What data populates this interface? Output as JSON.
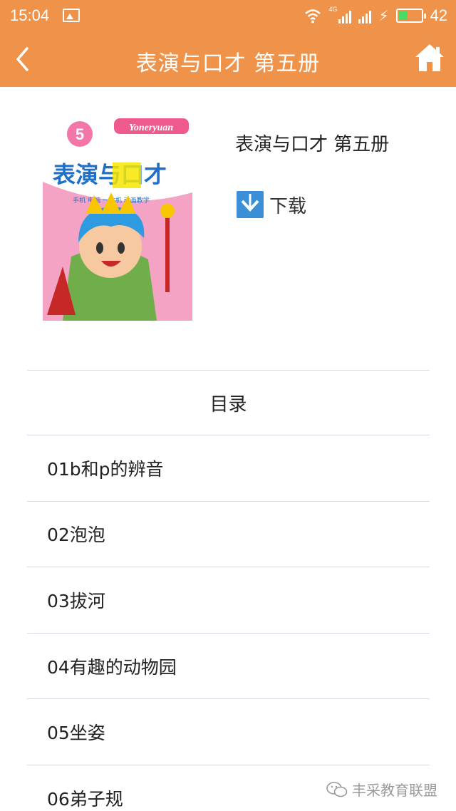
{
  "status_bar": {
    "time": "15:04",
    "network_label": "4G",
    "battery_percent": "42",
    "battery_level": 0.42,
    "icons": [
      "photo-icon",
      "wifi-icon",
      "signal-icon",
      "charging-icon",
      "battery-icon"
    ]
  },
  "nav": {
    "title": "表演与口才 第五册",
    "back_icon": "chevron-left-icon",
    "home_icon": "home-icon"
  },
  "book": {
    "title": "表演与口才 第五册",
    "download_label": "下载",
    "download_icon": "arrow-down-icon",
    "cover": {
      "brand": "Yoneryuan",
      "grade": "5",
      "title": "表演与口才",
      "tagline": "手机 电脑 一体机 动画教学"
    }
  },
  "toc": {
    "header": "目录",
    "items": [
      {
        "label": "01b和p的辨音"
      },
      {
        "label": "02泡泡"
      },
      {
        "label": "03拔河"
      },
      {
        "label": "04有趣的动物园"
      },
      {
        "label": "05坐姿"
      },
      {
        "label": "06弟子规"
      }
    ]
  },
  "watermark": {
    "text": "丰采教育联盟",
    "icon": "wechat-icon"
  },
  "colors": {
    "accent": "#f0934a",
    "download_blue": "#3a8fd6",
    "divider": "#d9d5e6",
    "cover_pink": "#f5a3c4",
    "cover_blue": "#1f6fc8",
    "cover_yellow": "#f7e600"
  }
}
